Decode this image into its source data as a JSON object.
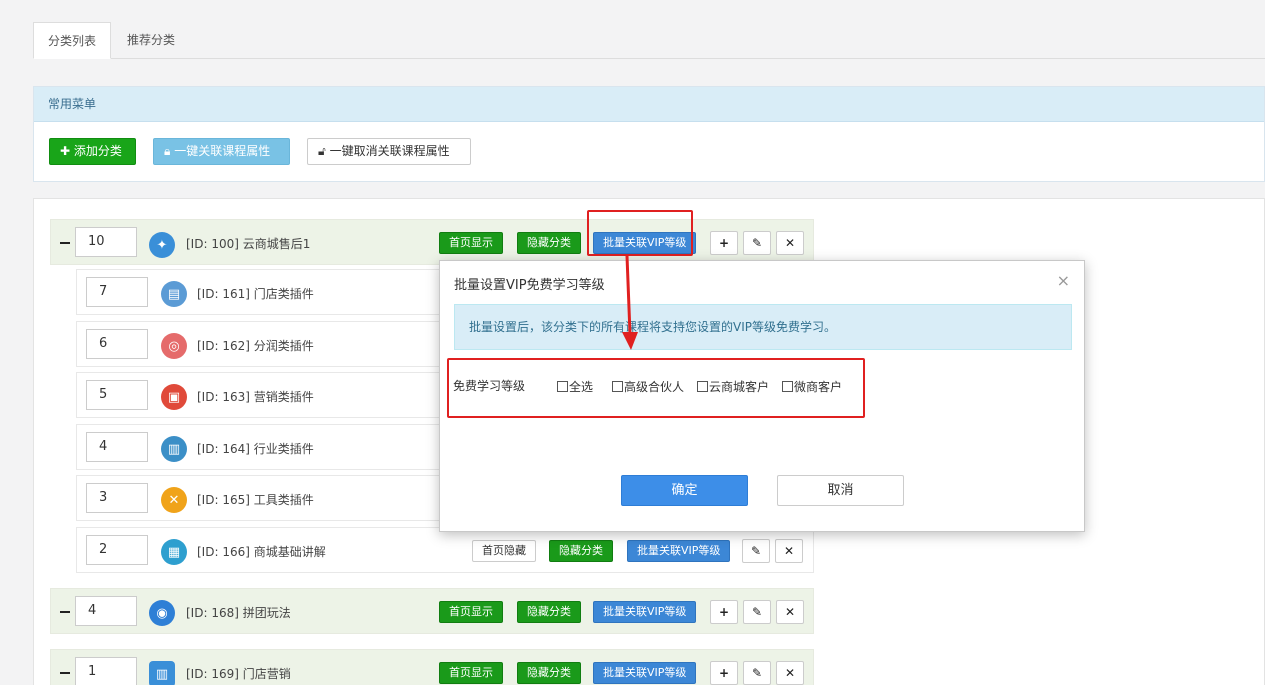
{
  "tabs": [
    {
      "label": "分类列表"
    },
    {
      "label": "推荐分类"
    }
  ],
  "panel": {
    "title": "常用菜单",
    "add_button": "添加分类",
    "link_button": "一键关联课程属性",
    "unlink_button": "一键取消关联课程属性"
  },
  "categories": [
    {
      "sort": "10",
      "label": "[ID: 100] 云商城售后1",
      "show_label": "首页显示",
      "hide_label": "隐藏分类",
      "vip_label": "批量关联VIP等级",
      "icon_color": "#3a8fd8"
    },
    {
      "sort": "7",
      "label": "[ID: 161] 门店类插件",
      "icon_color": "#5b9bd5"
    },
    {
      "sort": "6",
      "label": "[ID: 162] 分润类插件",
      "icon_color": "#e56b6b"
    },
    {
      "sort": "5",
      "label": "[ID: 163] 营销类插件",
      "icon_color": "#e04a3a"
    },
    {
      "sort": "4",
      "label": "[ID: 164] 行业类插件",
      "icon_color": "#3b8fc7"
    },
    {
      "sort": "3",
      "label": "[ID: 165] 工具类插件",
      "icon_color": "#f0a31a"
    },
    {
      "sort": "2",
      "label": "[ID: 166] 商城基础讲解",
      "show_label": "首页隐藏",
      "hide_label": "隐藏分类",
      "vip_label": "批量关联VIP等级",
      "icon_color": "#2e9fcf"
    },
    {
      "sort": "4",
      "label": "[ID: 168] 拼团玩法",
      "show_label": "首页显示",
      "hide_label": "隐藏分类",
      "vip_label": "批量关联VIP等级",
      "icon_color": "#2e7fd6"
    },
    {
      "sort": "1",
      "label": "[ID: 169] 门店营销",
      "show_label": "首页显示",
      "hide_label": "隐藏分类",
      "vip_label": "批量关联VIP等级",
      "icon_color": "#3a8fd8"
    }
  ],
  "modal": {
    "title": "批量设置VIP免费学习等级",
    "close": "×",
    "alert": "批量设置后，该分类下的所有课程将支持您设置的VIP等级免费学习。",
    "field_label": "免费学习等级",
    "options": [
      "全选",
      "高级合伙人",
      "云商城客户",
      "微商客户"
    ],
    "confirm": "确定",
    "cancel": "取消"
  },
  "colors": {
    "annotation_red": "#e02020",
    "primary_blue": "#3d8ee8",
    "success_green": "#1a9a1a"
  }
}
